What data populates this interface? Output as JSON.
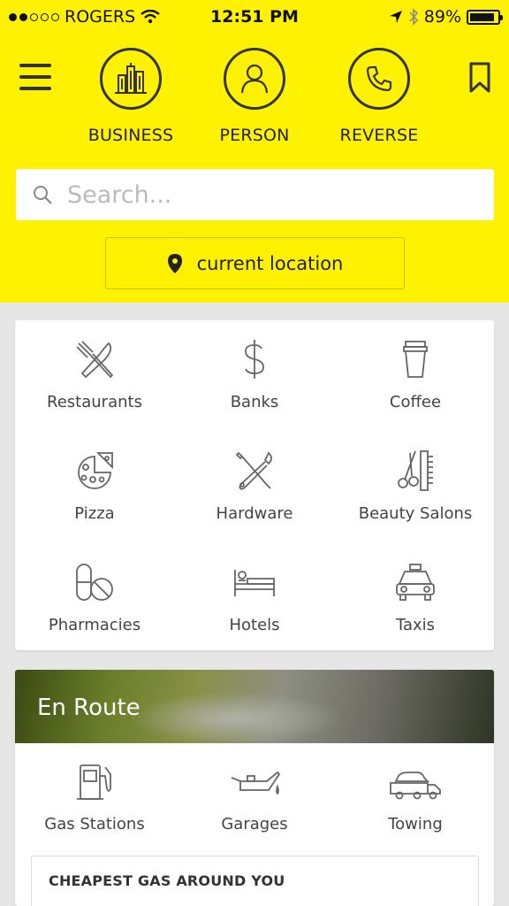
{
  "status_bar": {
    "carrier": "ROGERS",
    "time": "12:51 PM",
    "battery": "89%",
    "battery_level": 0.89,
    "signal_bars": 2,
    "signal_total": 5
  },
  "header": {
    "modes": [
      {
        "label": "BUSINESS",
        "icon": "buildings-icon"
      },
      {
        "label": "PERSON",
        "icon": "person-icon"
      },
      {
        "label": "REVERSE",
        "icon": "phone-icon"
      }
    ],
    "search_placeholder": "Search...",
    "location_label": "current location",
    "accent_color": "#fff200"
  },
  "categories": [
    {
      "label": "Restaurants",
      "icon": "fork-knife-icon"
    },
    {
      "label": "Banks",
      "icon": "dollar-icon"
    },
    {
      "label": "Coffee",
      "icon": "coffee-cup-icon"
    },
    {
      "label": "Pizza",
      "icon": "pizza-icon"
    },
    {
      "label": "Hardware",
      "icon": "tools-icon"
    },
    {
      "label": "Beauty Salons",
      "icon": "scissors-comb-icon"
    },
    {
      "label": "Pharmacies",
      "icon": "pills-icon"
    },
    {
      "label": "Hotels",
      "icon": "bed-icon"
    },
    {
      "label": "Taxis",
      "icon": "taxi-icon"
    }
  ],
  "en_route": {
    "title": "En Route",
    "items": [
      {
        "label": "Gas Stations",
        "icon": "gas-pump-icon"
      },
      {
        "label": "Garages",
        "icon": "oil-can-icon"
      },
      {
        "label": "Towing",
        "icon": "tow-truck-icon"
      }
    ],
    "gas_list_title": "CHEAPEST GAS AROUND YOU"
  }
}
